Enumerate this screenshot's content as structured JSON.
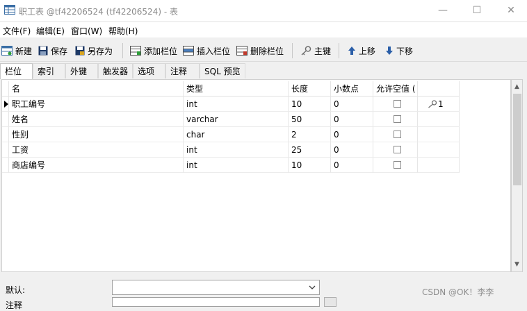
{
  "window": {
    "title": "职工表 @tf42206524 (tf42206524) - 表",
    "minimize_symbol": "—",
    "maximize_symbol": "☐",
    "close_symbol": "✕"
  },
  "menu": {
    "items": [
      "文件(F)",
      "编辑(E)",
      "窗口(W)",
      "帮助(H)"
    ]
  },
  "toolbar": {
    "new_label": "新建",
    "save_label": "保存",
    "save_as_label": "另存为",
    "add_field_label": "添加栏位",
    "insert_field_label": "插入栏位",
    "delete_field_label": "删除栏位",
    "primary_key_label": "主键",
    "move_up_label": "上移",
    "move_down_label": "下移"
  },
  "tabs": [
    "栏位",
    "索引",
    "外键",
    "触发器",
    "选项",
    "注释",
    "SQL 预览"
  ],
  "active_tab": "栏位",
  "grid": {
    "columns": [
      "名",
      "类型",
      "长度",
      "小数点",
      "允许空值 (",
      ""
    ],
    "rows": [
      {
        "name": "职工编号",
        "type": "int",
        "length": "10",
        "decimals": "0",
        "allow_null": false,
        "key": "1",
        "current": true
      },
      {
        "name": "姓名",
        "type": "varchar",
        "length": "50",
        "decimals": "0",
        "allow_null": false,
        "key": "",
        "current": false
      },
      {
        "name": "性别",
        "type": "char",
        "length": "2",
        "decimals": "0",
        "allow_null": false,
        "key": "",
        "current": false
      },
      {
        "name": "工资",
        "type": "int",
        "length": "25",
        "decimals": "0",
        "allow_null": false,
        "key": "",
        "current": false
      },
      {
        "name": "商店编号",
        "type": "int",
        "length": "10",
        "decimals": "0",
        "allow_null": false,
        "key": "",
        "current": false
      }
    ]
  },
  "properties": {
    "default_label": "默认:",
    "comment_label": "注释"
  },
  "watermark": "CSDN @OK！李李",
  "colors": {
    "titlebar": "#ffffff",
    "toolbar": "#f0f0f0",
    "grid_line": "#e6e6e6"
  }
}
